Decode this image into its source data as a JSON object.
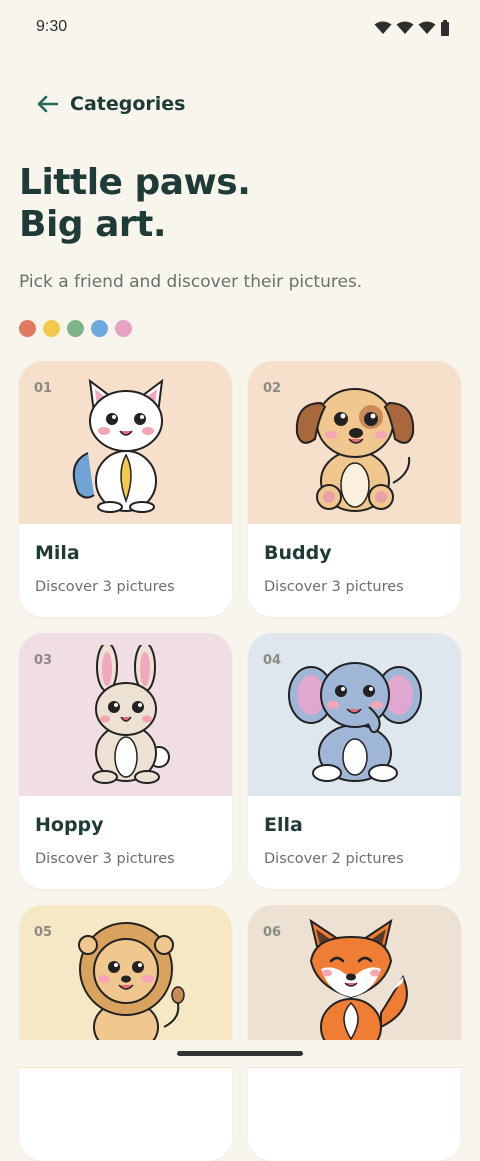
{
  "status_bar": {
    "time": "9:30"
  },
  "header": {
    "back_label": "Categories"
  },
  "hero": {
    "title_line1": "Little paws.",
    "title_line2": "Big art.",
    "subtitle": "Pick a friend and discover their pictures."
  },
  "dots": [
    "#e07a5f",
    "#f2c94c",
    "#7fb48a",
    "#6fa8dc",
    "#e8a2c4"
  ],
  "cards": [
    {
      "num": "01",
      "name": "Mila",
      "desc": "Discover 3 pictures",
      "bg": "#f6e0cb",
      "icon": "cat-icon"
    },
    {
      "num": "02",
      "name": "Buddy",
      "desc": "Discover 3 pictures",
      "bg": "#f6e0cb",
      "icon": "dog-icon"
    },
    {
      "num": "03",
      "name": "Hoppy",
      "desc": "Discover 3 pictures",
      "bg": "#f1dee5",
      "icon": "bunny-icon"
    },
    {
      "num": "04",
      "name": "Ella",
      "desc": "Discover 2 pictures",
      "bg": "#dfe7ee",
      "icon": "elephant-icon"
    },
    {
      "num": "05",
      "name": "",
      "desc": "",
      "bg": "#f6e8c4",
      "icon": "lion-icon"
    },
    {
      "num": "06",
      "name": "",
      "desc": "",
      "bg": "#ece1d3",
      "icon": "fox-icon"
    }
  ]
}
